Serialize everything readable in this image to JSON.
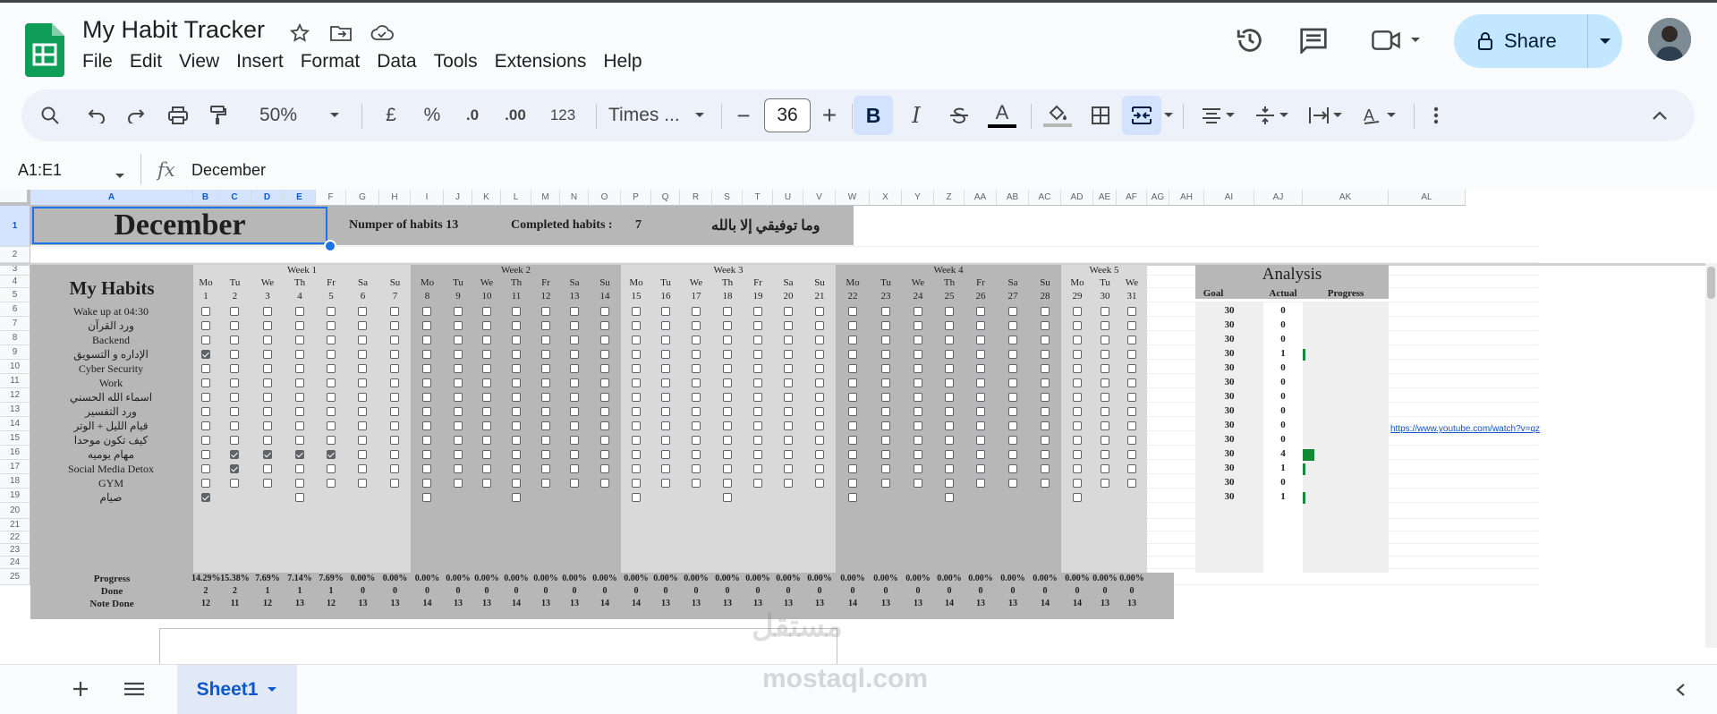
{
  "app": {
    "doc_title": "My Habit Tracker",
    "brand_color": "#0f9d58"
  },
  "menu": [
    "File",
    "Edit",
    "View",
    "Insert",
    "Format",
    "Data",
    "Tools",
    "Extensions",
    "Help"
  ],
  "share": {
    "label": "Share"
  },
  "toolbar": {
    "zoom": "50%",
    "currency": "£",
    "percent": "%",
    "dec_dec": ".0",
    "dec_inc": ".00",
    "number_format": "123",
    "font_name": "Times ...",
    "font_size": "36",
    "minus": "−",
    "plus": "+"
  },
  "formula_bar": {
    "name_box": "A1:E1",
    "fx": "fx",
    "value": "December"
  },
  "columns": [
    "A",
    "B",
    "C",
    "D",
    "E",
    "F",
    "G",
    "H",
    "I",
    "J",
    "K",
    "L",
    "M",
    "N",
    "O",
    "P",
    "Q",
    "R",
    "S",
    "T",
    "U",
    "V",
    "W",
    "X",
    "Y",
    "Z",
    "AA",
    "AB",
    "AC",
    "AD",
    "AE",
    "AF",
    "AG",
    "AH",
    "AI",
    "AJ",
    "AK",
    "AL"
  ],
  "rows": [
    "1",
    "2",
    "3",
    "4",
    "5",
    "6",
    "7",
    "8",
    "9",
    "10",
    "11",
    "12",
    "13",
    "14",
    "15",
    "16",
    "17",
    "18",
    "19",
    "20",
    "21",
    "22",
    "23",
    "24",
    "25"
  ],
  "sheet": {
    "month": "December",
    "num_habits_label": "Numper of habits 13",
    "completed_label": "Completed habits  :",
    "completed_value": "7",
    "quote": "وما توفيقي إلا بالله",
    "my_habits": "My Habits",
    "analysis": "Analysis",
    "goal_hdr": "Goal",
    "actual_hdr": "Actual",
    "progress_hdr": "Progress",
    "link": "https://www.youtube.com/watch?v=qz",
    "weeks": [
      "Week 1",
      "Week 2",
      "Week 3",
      "Week 4",
      "Week 5"
    ],
    "day_names": [
      "Mo",
      "Tu",
      "We",
      "Th",
      "Fr",
      "Sa",
      "Su",
      "Mo",
      "Tu",
      "We",
      "Th",
      "Fr",
      "Sa",
      "Su",
      "Mo",
      "Tu",
      "We",
      "Th",
      "Fr",
      "Sa",
      "Su",
      "Mo",
      "Tu",
      "We",
      "Th",
      "Fr",
      "Sa",
      "Su",
      "Mo",
      "Tu",
      "We"
    ],
    "day_numbers": [
      "1",
      "2",
      "3",
      "4",
      "5",
      "6",
      "7",
      "8",
      "9",
      "10",
      "11",
      "12",
      "13",
      "14",
      "15",
      "16",
      "17",
      "18",
      "19",
      "20",
      "21",
      "22",
      "23",
      "24",
      "25",
      "26",
      "27",
      "28",
      "29",
      "30",
      "31"
    ],
    "habits": [
      {
        "name": "Wake up at  04:30",
        "goal": "30",
        "actual": "0",
        "progress": 0
      },
      {
        "name": "ورد القرآن",
        "goal": "30",
        "actual": "0",
        "progress": 0
      },
      {
        "name": "Backend",
        "goal": "30",
        "actual": "0",
        "progress": 0
      },
      {
        "name": "الإداره و التسويق",
        "goal": "30",
        "actual": "1",
        "progress": 0.033
      },
      {
        "name": "Cyber Security",
        "goal": "30",
        "actual": "0",
        "progress": 0
      },
      {
        "name": "Work",
        "goal": "30",
        "actual": "0",
        "progress": 0
      },
      {
        "name": "اسماء الله الحسني",
        "goal": "30",
        "actual": "0",
        "progress": 0
      },
      {
        "name": "ورد التفسير",
        "goal": "30",
        "actual": "0",
        "progress": 0
      },
      {
        "name": "قيام الليل + الوتر",
        "goal": "30",
        "actual": "0",
        "progress": 0
      },
      {
        "name": "كيف تكون موحدا",
        "goal": "30",
        "actual": "0",
        "progress": 0
      },
      {
        "name": "مهام يوميه",
        "goal": "30",
        "actual": "4",
        "progress": 0.133
      },
      {
        "name": "Social Media Detox",
        "goal": "30",
        "actual": "1",
        "progress": 0.033
      },
      {
        "name": "GYM",
        "goal": "30",
        "actual": "0",
        "progress": 0
      },
      {
        "name": "صيام",
        "goal": "30",
        "actual": "1",
        "progress": 0.033
      }
    ],
    "checked": [
      [
        3,
        0
      ],
      [
        10,
        1
      ],
      [
        10,
        2
      ],
      [
        10,
        3
      ],
      [
        10,
        4
      ],
      [
        11,
        1
      ],
      [
        13,
        0
      ]
    ],
    "summary_labels": [
      "Progress",
      "Done",
      "Note Done"
    ],
    "progress_row": [
      "14.29%",
      "15.38%",
      "7.69%",
      "7.14%",
      "7.69%",
      "0.00%",
      "0.00%",
      "0.00%",
      "0.00%",
      "0.00%",
      "0.00%",
      "0.00%",
      "0.00%",
      "0.00%",
      "0.00%",
      "0.00%",
      "0.00%",
      "0.00%",
      "0.00%",
      "0.00%",
      "0.00%",
      "0.00%",
      "0.00%",
      "0.00%",
      "0.00%",
      "0.00%",
      "0.00%",
      "0.00%",
      "0.00%",
      "0.00%",
      "0.00%"
    ],
    "done_row": [
      "2",
      "2",
      "1",
      "1",
      "1",
      "0",
      "0",
      "0",
      "0",
      "0",
      "0",
      "0",
      "0",
      "0",
      "0",
      "0",
      "0",
      "0",
      "0",
      "0",
      "0",
      "0",
      "0",
      "0",
      "0",
      "0",
      "0",
      "0",
      "0",
      "0",
      "0"
    ],
    "not_done_row": [
      "12",
      "11",
      "12",
      "13",
      "12",
      "13",
      "13",
      "14",
      "13",
      "13",
      "14",
      "13",
      "13",
      "14",
      "14",
      "13",
      "13",
      "13",
      "13",
      "13",
      "13",
      "14",
      "13",
      "13",
      "14",
      "13",
      "13",
      "14",
      "14",
      "13",
      "13"
    ]
  },
  "tabs": {
    "sheet1": "Sheet1"
  },
  "watermark": {
    "ar": "مستقل",
    "en": "mostaql.com"
  }
}
